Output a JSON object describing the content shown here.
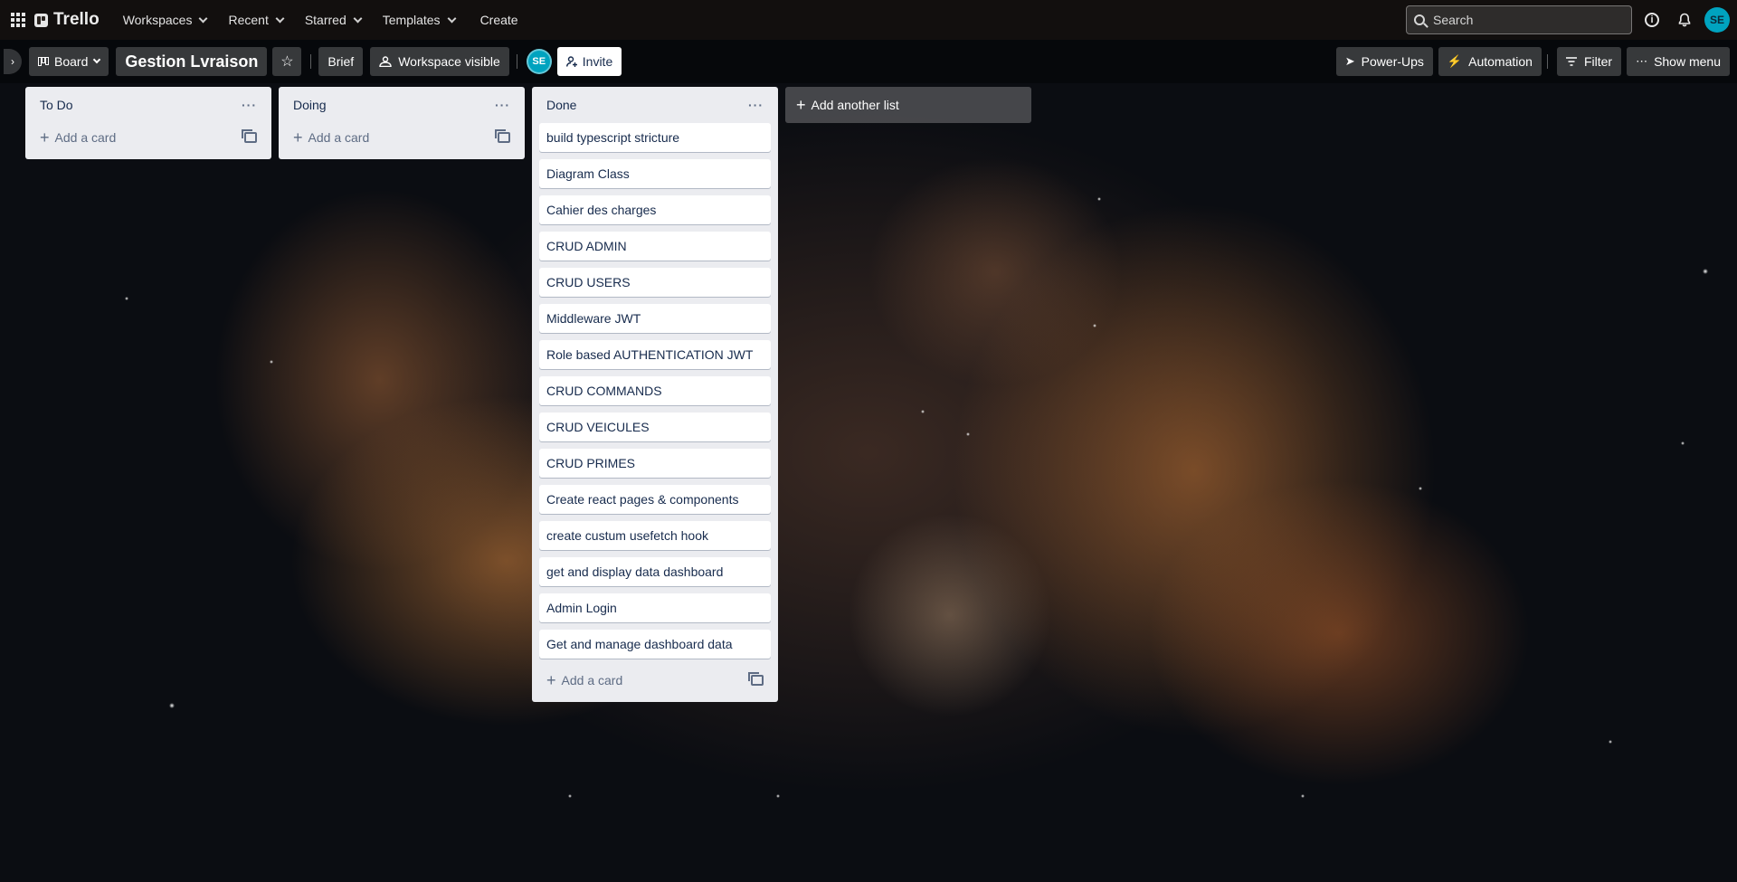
{
  "topbar": {
    "brand": "Trello",
    "nav": [
      {
        "label": "Workspaces"
      },
      {
        "label": "Recent"
      },
      {
        "label": "Starred"
      },
      {
        "label": "Templates"
      }
    ],
    "create_label": "Create",
    "search_placeholder": "Search",
    "user_initials": "SE"
  },
  "boardbar": {
    "view_label": "Board",
    "board_title": "Gestion Lvraison",
    "brief_label": "Brief",
    "visibility_label": "Workspace visible",
    "member_initials": "SE",
    "invite_label": "Invite",
    "powerups_label": "Power-Ups",
    "automation_label": "Automation",
    "filter_label": "Filter",
    "show_menu_label": "Show menu"
  },
  "lists": [
    {
      "title": "To Do",
      "cards": [],
      "add_card_label": "Add a card"
    },
    {
      "title": "Doing",
      "cards": [],
      "add_card_label": "Add a card"
    },
    {
      "title": "Done",
      "cards": [
        "build typescript stricture",
        "Diagram Class",
        "Cahier des charges",
        "CRUD ADMIN",
        "CRUD USERS",
        "Middleware JWT",
        "Role based AUTHENTICATION JWT",
        "CRUD COMMANDS",
        "CRUD VEICULES",
        "CRUD PRIMES",
        "Create react pages & components",
        "create custum usefetch hook",
        "get and display data dashboard",
        "Admin Login",
        "Get and manage dashboard data"
      ],
      "add_card_label": "Add a card"
    }
  ],
  "add_list_label": "Add another list",
  "icons": {
    "apps": "apps-grid-icon",
    "info": "info-icon",
    "bell": "bell-icon",
    "star": "star-icon",
    "menu": "ellipsis-icon",
    "template": "card-template-icon"
  }
}
